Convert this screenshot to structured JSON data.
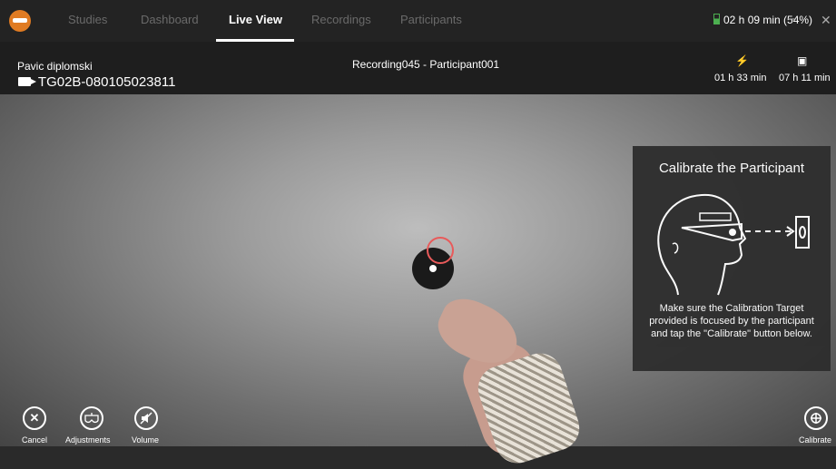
{
  "nav": {
    "tabs": [
      {
        "label": "Studies"
      },
      {
        "label": "Dashboard"
      },
      {
        "label": "Live View"
      },
      {
        "label": "Recordings"
      },
      {
        "label": "Participants"
      }
    ],
    "active_tab": "Live View",
    "battery": "02 h 09 min (54%)",
    "minimize": "–",
    "close": "✕"
  },
  "header": {
    "project": "Pavic diplomski",
    "device": "TG02B-080105023811",
    "recording": "Recording045 - Participant001",
    "battery_remaining": "01 h 33 min",
    "storage_remaining": "07 h 11 min"
  },
  "calibrate_panel": {
    "title": "Calibrate the Participant",
    "text": "Make sure the Calibration Target provided is focused by the participant and tap the \"Calibrate\" button below."
  },
  "controls": {
    "cancel": "Cancel",
    "adjustments": "Adjustments",
    "volume": "Volume",
    "calibrate": "Calibrate"
  },
  "colors": {
    "brand": "#e07b22",
    "gaze": "#e85a5a",
    "battery": "#4caf50"
  }
}
